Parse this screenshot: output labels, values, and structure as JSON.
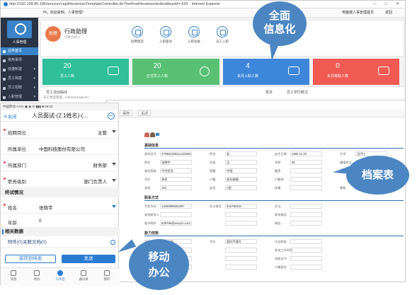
{
  "browser": {
    "window_title": "http://192.168.80.186/seeyon/cap4/businessTemplateController.do?method=businessIndex&busId=-620 - Internet Explorer",
    "window_controls": "— □ ✕"
  },
  "topbar": {
    "greeting": "Hi，欢迎来到，人事管理！",
    "right_link": "电脑端人事管理首页",
    "back_link": "返回"
  },
  "sidebar": {
    "app_label": "人事管理",
    "items": [
      {
        "label": "业务首页",
        "active": true
      },
      {
        "label": "常用事项",
        "active": false
      },
      {
        "label": "快捷新建",
        "active": false
      },
      {
        "label": "员工档案",
        "active": false
      },
      {
        "label": "员工招聘",
        "active": false
      },
      {
        "label": "入职管理",
        "active": false
      }
    ]
  },
  "welcome": {
    "badge": "助理",
    "name": "行政助理",
    "subtitle": "行政负责人",
    "quick_links": [
      "招聘需求",
      "入职面试",
      "入职准备",
      "员工入职"
    ]
  },
  "stats": [
    {
      "value": "20",
      "label": "员工人数",
      "color": "#2fbf9a"
    },
    {
      "value": "20",
      "label": "正式员工人数",
      "color": "#58c173"
    },
    {
      "value": "4",
      "label": "本月入职人数",
      "color": "#3d86d9"
    },
    {
      "value": "0",
      "label": "本月离职人数",
      "color": "#f05a52"
    }
  ],
  "bottom_panels": {
    "left": "员工流动曲线",
    "left_more": "更多",
    "right": "员工学历概况",
    "sub_window_title": "员工档案管理 - Internet Explorer"
  },
  "form_window": {
    "toolbar": [
      "保存",
      "关闭"
    ],
    "sections": {
      "basic": "基础信息",
      "contact": "联系方式",
      "ability": "能力技能"
    },
    "basic_rows": [
      [
        {
          "label": "身份证号",
          "value": "370982198211220826"
        },
        {
          "label": "性别",
          "value": "女"
        },
        {
          "label": "出生日期",
          "value": "1992-11-22"
        },
        {
          "label": "生肖",
          "value": "丑(牛)"
        }
      ],
      [
        {
          "label": "姓名",
          "value": "张晓宇"
        },
        {
          "label": "民族",
          "value": "汉"
        },
        {
          "label": "年龄",
          "value": "36"
        },
        {
          "label": "婚姻状况",
          "value": "已婚"
        }
      ],
      [
        {
          "label": "政治面貌",
          "value": "中共党员"
        },
        {
          "label": "国籍",
          "value": "中国"
        },
        {
          "label": "籍贯",
          "value": ""
        },
        {
          "label": "",
          "value": ""
        }
      ],
      [
        {
          "label": "学历",
          "value": "本科"
        },
        {
          "label": "户籍",
          "value": "农村城镇"
        },
        {
          "label": "户籍地",
          "value": ""
        },
        {
          "label": "",
          "value": ""
        }
      ],
      [
        {
          "label": "身高",
          "value": "162"
        },
        {
          "label": "血型",
          "value": "A型"
        },
        {
          "label": "体重",
          "value": ""
        },
        {
          "label": "属相",
          "value": "猴"
        }
      ]
    ],
    "contact_rows": [
      [
        {
          "label": "手机号码",
          "value": "13469988553357"
        },
        {
          "label": "办公电话",
          "value": "042790434"
        },
        {
          "label": "住址",
          "value": ""
        },
        {
          "label": "",
          "value": ""
        }
      ],
      [
        {
          "label": "紧急联系人",
          "value": ""
        },
        {
          "label": "",
          "value": ""
        },
        {
          "label": "联系电话",
          "value": ""
        },
        {
          "label": "",
          "value": ""
        }
      ],
      [
        {
          "label": "电子邮件",
          "value": "529796@seeyon.com"
        },
        {
          "label": "",
          "value": ""
        },
        {
          "label": "微信",
          "value": ""
        },
        {
          "label": "",
          "value": ""
        }
      ]
    ],
    "ability_rows": [
      [
        {
          "label": "学历",
          "value": "大学本科"
        },
        {
          "label": "学位",
          "value": "暂时不填写"
        },
        {
          "label": "毕业院校",
          "value": ""
        },
        {
          "label": "",
          "value": ""
        }
      ],
      [
        {
          "label": "专业",
          "value": ""
        },
        {
          "label": "",
          "value": ""
        },
        {
          "label": "参加工作时间",
          "value": ""
        },
        {
          "label": "",
          "value": ""
        }
      ],
      [
        {
          "label": "外语水平",
          "value": ""
        },
        {
          "label": "",
          "value": ""
        },
        {
          "label": "技能证书",
          "value": ""
        },
        {
          "label": "",
          "value": ""
        }
      ],
      [
        {
          "label": "计算机水平",
          "value": ""
        },
        {
          "label": "",
          "value": ""
        },
        {
          "label": "兴趣爱好",
          "value": ""
        },
        {
          "label": "",
          "value": ""
        }
      ]
    ]
  },
  "phone": {
    "status_bar": "中国移动  3 K/s  ▣ ◉  ✉  ▮▮▮ ■ 09:32",
    "close": "关闭",
    "title": "人员面试-(2.1姓名)-(...",
    "rows": {
      "position_label": "招聘岗位",
      "position_value": "主管",
      "company_label": "所属单位",
      "company_value": "中国科技股份有限公司",
      "dept_label": "所属部门",
      "dept_value": "财务部",
      "level_label": "职务级别",
      "level_value": "部门负责人"
    },
    "group_final": "终试情况",
    "name_label": "姓名",
    "name_value": "张晓宇",
    "age_label": "年龄",
    "age_value": "0",
    "group_related": "相关数据",
    "attachment": "附件(0)关联文档(0)",
    "save_draft": "保存到待发",
    "send": "发送",
    "tabs": [
      {
        "label": "消息",
        "active": false
      },
      {
        "label": "待办",
        "active": false
      },
      {
        "label": "工作台",
        "active": true
      },
      {
        "label": "通讯录",
        "active": false
      },
      {
        "label": "我的",
        "active": false
      }
    ]
  },
  "callouts": {
    "info": [
      "全面",
      "信息化"
    ],
    "archive": "档案表",
    "mobile": [
      "移动",
      "办公"
    ],
    "color": "#4b86c3"
  }
}
